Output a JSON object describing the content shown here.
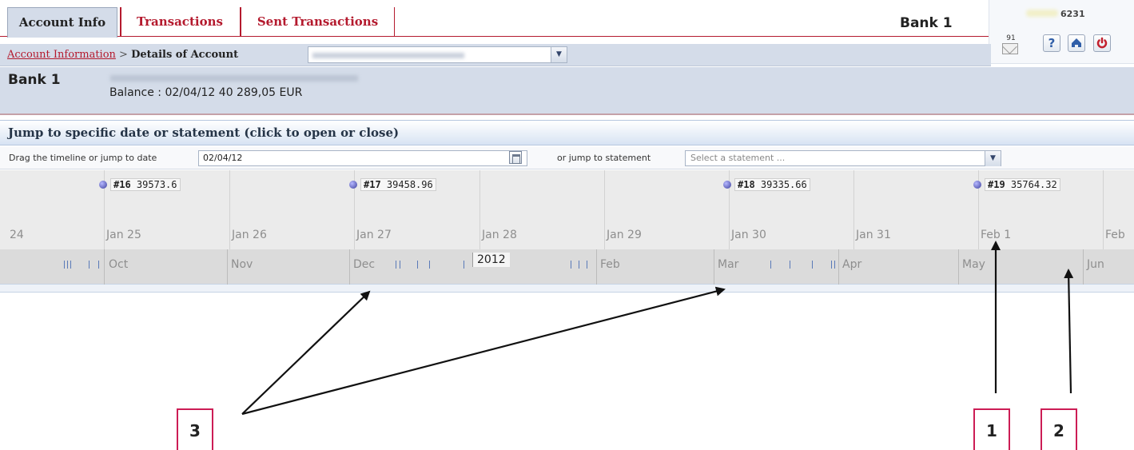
{
  "tabs": [
    {
      "label": "Account Info"
    },
    {
      "label": "Transactions"
    },
    {
      "label": "Sent Transactions"
    }
  ],
  "bank_top": "Bank 1",
  "widget": {
    "number": "6231",
    "mail_count": "91",
    "help_glyph": "?",
    "icons": [
      "mail-icon",
      "help-icon",
      "home-icon",
      "power-icon"
    ]
  },
  "breadcrumb": {
    "link": "Account Information",
    "separator": ">",
    "current": "Details of Account"
  },
  "account_panel": {
    "bank_name": "Bank 1",
    "balance": "Balance : 02/04/12 40 289,05 EUR"
  },
  "jump": {
    "title": "Jump to specific date or statement (click to open or close)",
    "drag_label": "Drag the timeline or jump to date",
    "date_value": "02/04/12",
    "statement_label": "or jump to statement",
    "statement_placeholder": "Select a statement ..."
  },
  "timeline": {
    "markers": [
      {
        "num": "#16",
        "value": "39573.6"
      },
      {
        "num": "#17",
        "value": "39458.96"
      },
      {
        "num": "#18",
        "value": "39335.66"
      },
      {
        "num": "#19",
        "value": "35764.32"
      }
    ],
    "days": [
      "24",
      "Jan 25",
      "Jan 26",
      "Jan 27",
      "Jan 28",
      "Jan 29",
      "Jan 30",
      "Jan 31",
      "Feb 1",
      "Feb"
    ],
    "months": [
      "Oct",
      "Nov",
      "Dec",
      "Feb",
      "Mar",
      "Apr",
      "May",
      "Jun"
    ],
    "year": "2012"
  },
  "callouts": [
    "3",
    "1",
    "2"
  ],
  "colors": {
    "brand_red": "#b41a2e",
    "panel_blue": "#d4dce9",
    "callout_pink": "#cc1d55"
  }
}
